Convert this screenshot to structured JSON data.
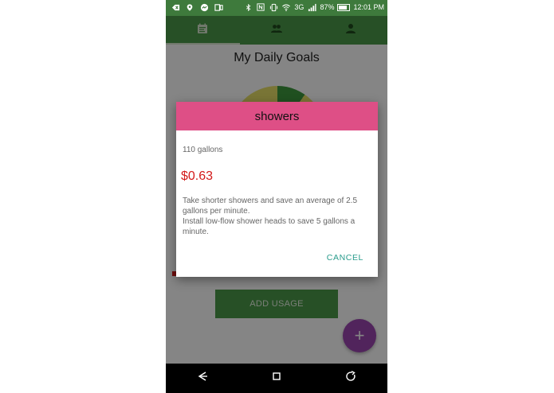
{
  "status_bar": {
    "battery_pct": "87%",
    "time": "12:01",
    "time_suffix": "PM",
    "network": "3G",
    "icons_left": [
      "notification-icon",
      "location-icon",
      "messenger-icon",
      "device-icon"
    ],
    "icons_right": [
      "bluetooth-icon",
      "nfc-icon",
      "vibrate-icon",
      "wifi-icon",
      "signal-icon",
      "battery-icon"
    ]
  },
  "tabs": [
    {
      "icon": "calendar-icon",
      "active": true
    },
    {
      "icon": "group-icon",
      "active": false
    },
    {
      "icon": "person-icon",
      "active": false
    }
  ],
  "page": {
    "title": "My Daily Goals",
    "add_usage_label": "ADD USAGE",
    "fab_label": "+"
  },
  "dialog": {
    "title": "showers",
    "gallons": "110 gallons",
    "cost": "$0.63",
    "tips": [
      "Take shorter showers and save an average of 2.5 gallons per minute.",
      "Install low-flow shower heads to save 5 gallons a minute."
    ],
    "cancel_label": "CANCEL"
  },
  "colors": {
    "status_bar": "#3e7a3c",
    "tab_bar": "#4c9a49",
    "dialog_header": "#de4f86",
    "cost_text": "#d31a1a",
    "cancel_text": "#2a9c8c",
    "fab": "#9b45b0"
  },
  "nav": [
    "back-icon",
    "home-icon",
    "recents-icon"
  ]
}
